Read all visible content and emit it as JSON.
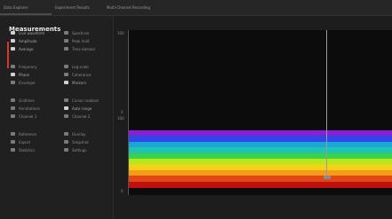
{
  "breadcrumbs": [
    "Data Explorer",
    "Experiment Results",
    "Multi-Channel Recording"
  ],
  "sidebar": {
    "title": "Measurements",
    "options": [
      {
        "label": "Live waveform",
        "checked": true
      },
      {
        "label": "Spectrum",
        "checked": false
      },
      {
        "label": "Amplitude",
        "checked": true
      },
      {
        "label": "Peak hold",
        "checked": false
      },
      {
        "label": "Average",
        "checked": true
      },
      {
        "label": "Time domain",
        "checked": false
      },
      {
        "label": "Frequency",
        "checked": false
      },
      {
        "label": "Log scale",
        "checked": false
      },
      {
        "label": "Phase",
        "checked": true
      },
      {
        "label": "Coherence",
        "checked": false
      },
      {
        "label": "Envelope",
        "checked": false
      },
      {
        "label": "Markers",
        "checked": true
      },
      {
        "label": "Gridlines",
        "checked": false
      },
      {
        "label": "Cursor readout",
        "checked": false
      },
      {
        "label": "Annotations",
        "checked": false
      },
      {
        "label": "Auto range",
        "checked": true
      },
      {
        "label": "Channel 1",
        "checked": false
      },
      {
        "label": "Channel 2",
        "checked": false
      },
      {
        "label": "Reference",
        "checked": false
      },
      {
        "label": "Overlay",
        "checked": false
      },
      {
        "label": "Export",
        "checked": false
      },
      {
        "label": "Snapshot",
        "checked": false
      },
      {
        "label": "Statistics",
        "checked": false
      },
      {
        "label": "Settings",
        "checked": false
      }
    ]
  },
  "plots": {
    "top": {
      "y_max_label": "100",
      "y_min_label": "0"
    },
    "bottom": {
      "y_max_label": "100",
      "y_min_label": "0"
    }
  },
  "spectrum_colors": [
    "#8a1fd6",
    "#2f46e8",
    "#1aa7d6",
    "#20c2b0",
    "#39d24a",
    "#b6e81e",
    "#f0d21a",
    "#f59a1a",
    "#e04a12",
    "#c21010"
  ],
  "accent_color": "#d23a2a"
}
